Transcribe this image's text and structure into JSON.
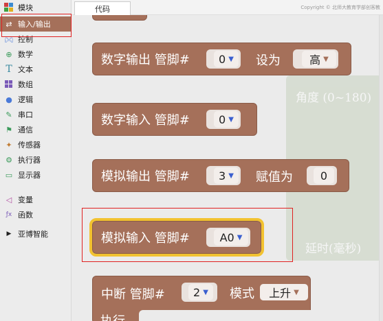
{
  "sidebar": {
    "header": "模块",
    "items": [
      {
        "label": "输入/输出",
        "icon": "io-arrows-icon"
      },
      {
        "label": "控制",
        "icon": "gamepad-icon"
      },
      {
        "label": "数学",
        "icon": "math-icon"
      },
      {
        "label": "文本",
        "icon": "text-icon"
      },
      {
        "label": "数组",
        "icon": "array-icon"
      },
      {
        "label": "逻辑",
        "icon": "logic-icon"
      },
      {
        "label": "串口",
        "icon": "serial-icon"
      },
      {
        "label": "通信",
        "icon": "communication-icon"
      },
      {
        "label": "传感器",
        "icon": "sensor-icon"
      },
      {
        "label": "执行器",
        "icon": "actuator-icon"
      },
      {
        "label": "显示器",
        "icon": "display-icon"
      },
      {
        "label": "变量",
        "icon": "variable-icon"
      },
      {
        "label": "函数",
        "icon": "function-icon"
      },
      {
        "label": "亚博智能",
        "icon": "triangle-right-icon"
      }
    ]
  },
  "tabs": {
    "code": "代码"
  },
  "copyright": "Copyright © 北师大教育学部创客教",
  "blocks": {
    "digital_out": {
      "label": "数字输出 管脚#",
      "pin": "0",
      "set_label": "设为",
      "value": "高"
    },
    "digital_in": {
      "label": "数字输入 管脚#",
      "pin": "0"
    },
    "analog_out": {
      "label": "模拟输出 管脚#",
      "pin": "3",
      "assign_label": "赋值为",
      "value": "0"
    },
    "analog_in": {
      "label": "模拟输入 管脚#",
      "pin": "A0"
    },
    "interrupt": {
      "label": "中断 管脚#",
      "pin": "2",
      "mode_label": "模式",
      "mode": "上升",
      "exec_label": "执行"
    }
  },
  "ghost": {
    "angle": "角度 (0~180)",
    "delay": "延时(毫秒)"
  },
  "colors": {
    "block": "#a5705a",
    "highlight": "#f2c230",
    "active_category": "#a5705a",
    "annotation": "#e02020"
  }
}
